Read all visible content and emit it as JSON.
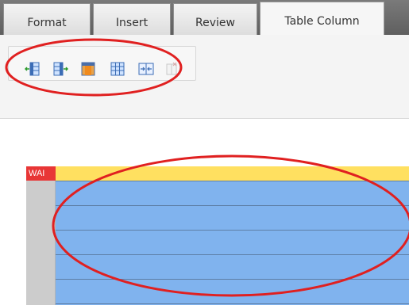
{
  "tabs": [
    {
      "label": "Format",
      "active": false
    },
    {
      "label": "Insert",
      "active": false
    },
    {
      "label": "Review",
      "active": false
    },
    {
      "label": "Table Column",
      "active": true
    }
  ],
  "toolbar": {
    "icons": [
      "insert-column-left-icon",
      "insert-column-right-icon",
      "delete-column-icon",
      "select-column-icon",
      "column-width-icon",
      "column-properties-icon"
    ]
  },
  "table": {
    "badge": "WAI",
    "row_count": 5
  },
  "colors": {
    "tabbar": "#6b6b6b",
    "header_row": "#ffe060",
    "selection": "#80b3ee",
    "annotation": "#e02020",
    "badge": "#e83636"
  }
}
